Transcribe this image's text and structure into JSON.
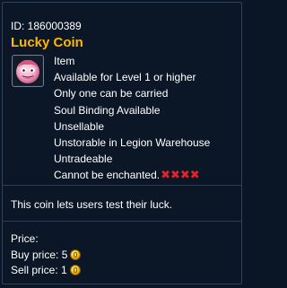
{
  "item": {
    "id_text": "ID: 186000389",
    "name": "Lucky Coin",
    "name_color": "#ffb800",
    "icon": "lucky-coin-face-icon",
    "attributes": [
      "Item",
      "Available for Level 1 or higher",
      "Only one can be carried",
      "Soul Binding Available",
      "Unsellable",
      "Unstorable in Legion Warehouse",
      "Untradeable",
      "Cannot be enchanted."
    ],
    "enchant_marks": "✖✖✖✖",
    "enchant_mark_color": "#e3232b",
    "description": "This coin lets users test their luck.",
    "price": {
      "label": "Price:",
      "buy_label": "Buy price: ",
      "buy_value": "5",
      "sell_label": "Sell price: ",
      "sell_value": "1",
      "currency_icon": "gold-coin-icon"
    }
  }
}
